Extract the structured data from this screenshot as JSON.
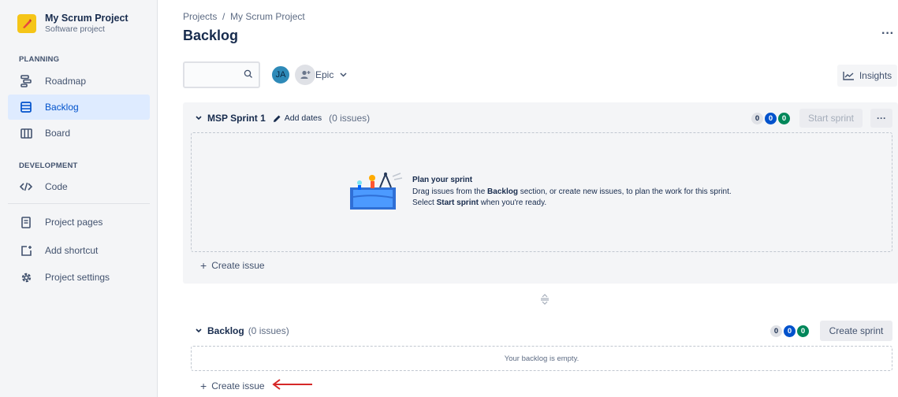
{
  "sidebar": {
    "project_name": "My Scrum Project",
    "project_type": "Software project",
    "planning_label": "PLANNING",
    "development_label": "DEVELOPMENT",
    "items": {
      "roadmap": "Roadmap",
      "backlog": "Backlog",
      "board": "Board",
      "code": "Code",
      "project_pages": "Project pages",
      "add_shortcut": "Add shortcut",
      "project_settings": "Project settings"
    }
  },
  "header": {
    "breadcrumb": "Projects  /  My Scrum Project",
    "title": "Backlog",
    "more": "···"
  },
  "toolbar": {
    "avatar_initials": "JA",
    "epic_label": "Epic",
    "insights_label": "Insights"
  },
  "sprint": {
    "name": "MSP Sprint 1",
    "add_dates": "Add dates",
    "issue_count": "(0 issues)",
    "counts": [
      "0",
      "0",
      "0"
    ],
    "start_label": "Start sprint",
    "more": "···",
    "plan_title": "Plan your sprint",
    "plan_text_1": "Drag issues from the ",
    "plan_text_bold1": "Backlog",
    "plan_text_2": " section, or create new issues, to plan the work for this sprint. Select ",
    "plan_text_bold2": "Start sprint",
    "plan_text_3": " when you're ready.",
    "create_issue": "Create issue"
  },
  "backlog": {
    "name": "Backlog",
    "issue_count": "(0 issues)",
    "counts": [
      "0",
      "0",
      "0"
    ],
    "create_sprint": "Create sprint",
    "empty_text": "Your backlog is empty.",
    "create_issue": "Create issue"
  },
  "colors": {
    "accent": "#0052cc",
    "green": "#00875a",
    "annotation_arrow": "#d62828"
  }
}
